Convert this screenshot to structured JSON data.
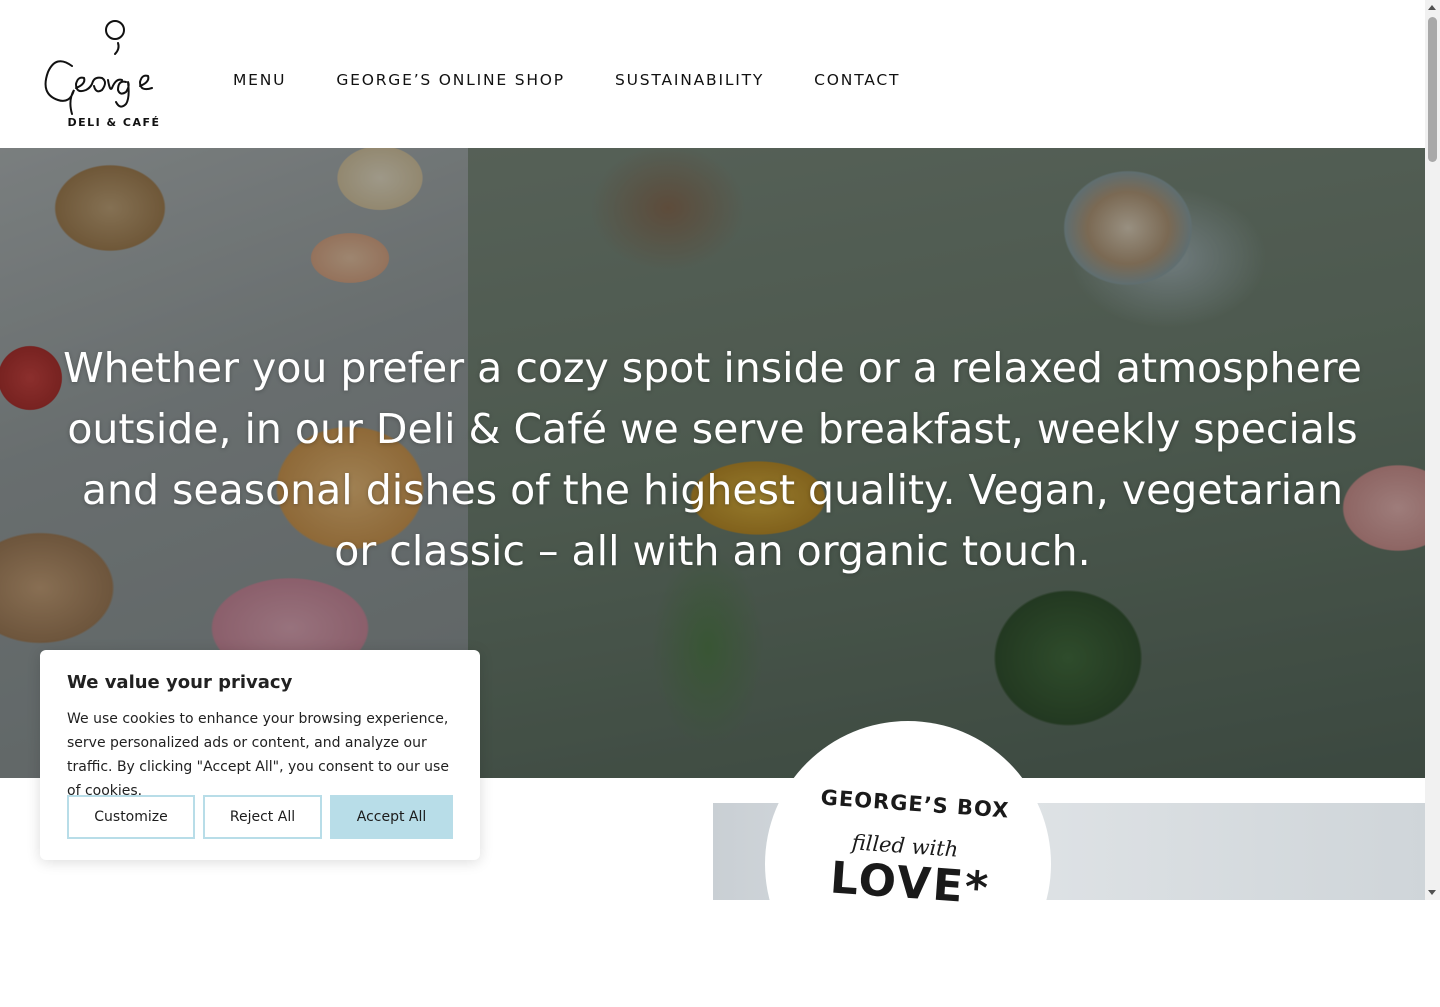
{
  "logo": {
    "script_text": "George",
    "subtitle": "DELI & CAFÉ",
    "icon": "george-logo-icon"
  },
  "nav": {
    "items": [
      {
        "label": "MENU"
      },
      {
        "label": "GEORGE’S ONLINE SHOP"
      },
      {
        "label": "SUSTAINABILITY"
      },
      {
        "label": "CONTACT"
      }
    ]
  },
  "hero": {
    "text": "Whether you prefer a cozy spot inside or a relaxed atmosphere outside, in our Deli & Café we serve breakfast, weekly specials and seasonal dishes of the highest quality. Vegan, vegetarian or classic – all with an organic touch."
  },
  "promo": {
    "line1": "GEORGE’S BOX",
    "line2": "filled with",
    "line3": "LOVE*"
  },
  "cookie": {
    "title": "We value your privacy",
    "text": "We use cookies to enhance your browsing experience, serve personalized ads or content, and analyze our traffic. By clicking \"Accept All\", you consent to our use of cookies.",
    "buttons": {
      "customize": "Customize",
      "reject": "Reject All",
      "accept": "Accept All"
    }
  },
  "colors": {
    "accept_button": "#b8dde8",
    "text_dark": "#212121",
    "hero_text": "#ffffff"
  }
}
